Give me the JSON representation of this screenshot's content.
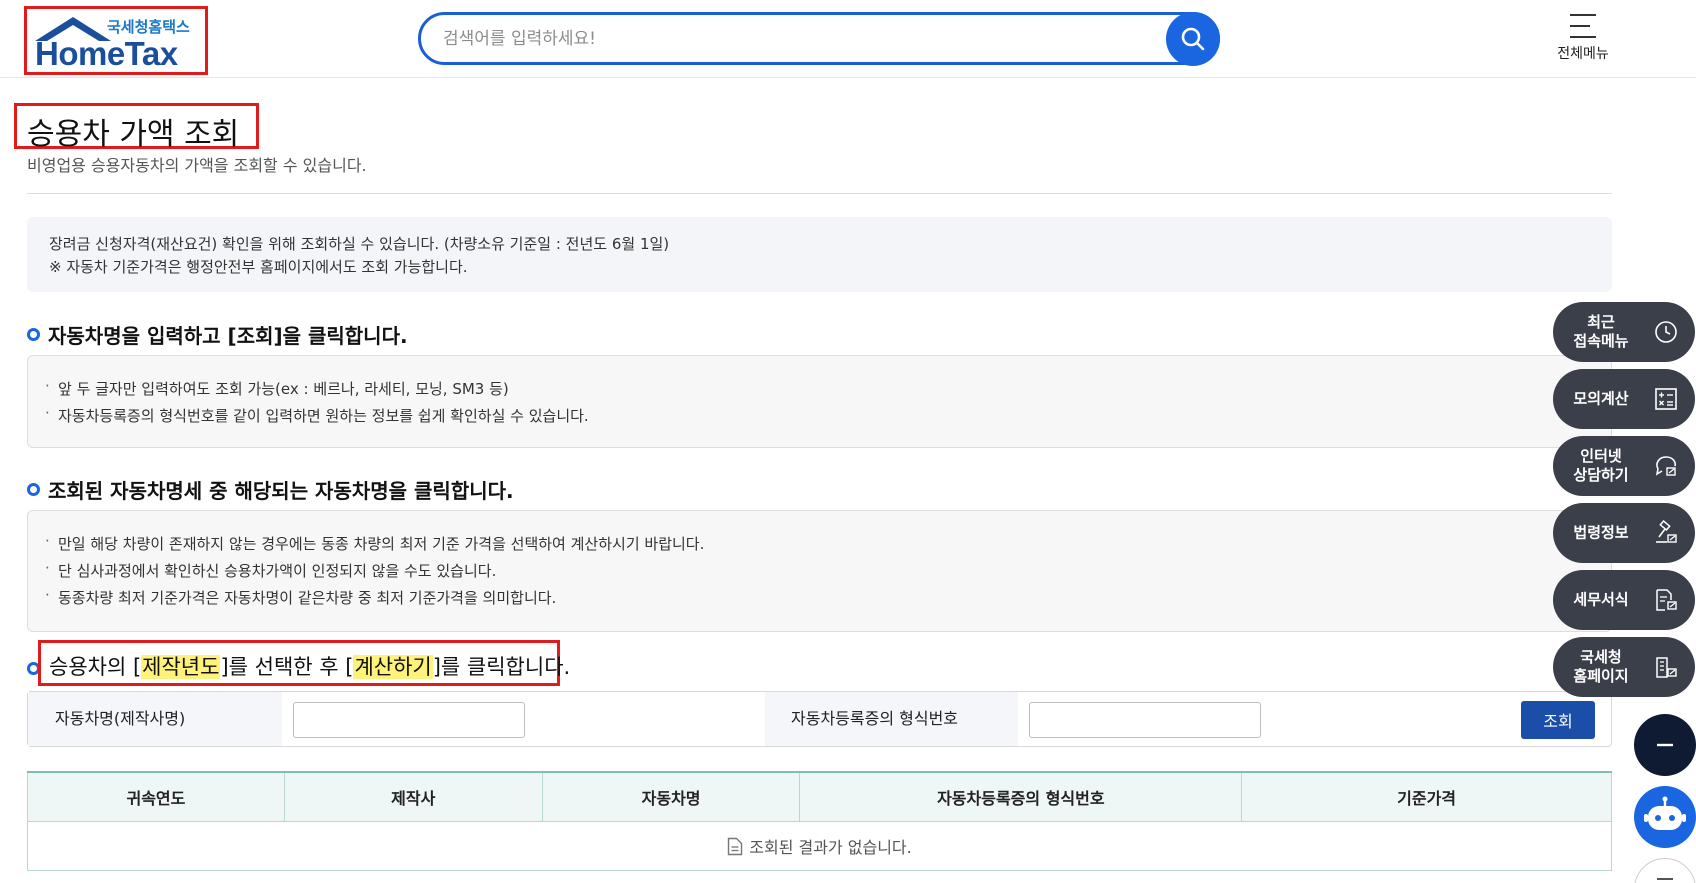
{
  "header": {
    "logo_sub": "국세청홈택스",
    "logo_main": "HomeTax",
    "search_placeholder": "검색어를 입력하세요!",
    "menu_label": "전체메뉴"
  },
  "page": {
    "title": "승용차 가액 조회",
    "description": "비영업용 승용자동차의 가액을 조회할 수 있습니다."
  },
  "info": {
    "line1": "장려금 신청자격(재산요건) 확인을 위해 조회하실 수 있습니다. (차량소유 기준일 : 전년도 6월 1일)",
    "line2": "※ 자동차 기준가격은 행정안전부 홈페이지에서도 조회 가능합니다."
  },
  "step1": {
    "heading": "자동차명을 입력하고 [조회]을 클릭합니다.",
    "items": [
      "앞 두 글자만 입력하여도 조회 가능(ex : 베르나, 라세티, 모닝, SM3 등)",
      "자동차등록증의 형식번호를 같이 입력하면 원하는 정보를 쉽게 확인하실 수 있습니다."
    ]
  },
  "step2": {
    "heading": "조회된 자동차명세 중 해당되는 자동차명을 클릭합니다.",
    "items": [
      "만일 해당 차량이 존재하지 않는 경우에는 동종 차량의 최저 기준 가격을 선택하여 계산하시기 바랍니다.",
      "단 심사과정에서 확인하신 승용차가액이 인정되지 않을 수도 있습니다.",
      "동종차량 최저 기준가격은 자동차명이 같은차량 중  최저 기준가격을 의미합니다."
    ]
  },
  "step3": {
    "prefix": "승용차의 [",
    "highlight1": "제작년도",
    "middle": "]를 선택한 후 [",
    "highlight2": "계산하기",
    "suffix": "]를 클릭합니다."
  },
  "form": {
    "car_name_label": "자동차명(제작사명)",
    "car_name_value": "",
    "type_number_label": "자동차등록증의 형식번호",
    "type_number_value": "",
    "search_button": "조회"
  },
  "table": {
    "columns": [
      "귀속연도",
      "제작사",
      "자동차명",
      "자동차등록증의 형식번호",
      "기준가격"
    ],
    "empty_message": "조회된 결과가 없습니다."
  },
  "quick_menu": [
    {
      "label_line1": "최근",
      "label_line2": "접속메뉴",
      "icon": "clock-icon"
    },
    {
      "label_line1": "모의계산",
      "label_line2": "",
      "icon": "calculator-icon"
    },
    {
      "label_line1": "인터넷",
      "label_line2": "상담하기",
      "icon": "chat-icon"
    },
    {
      "label_line1": "법령정보",
      "label_line2": "",
      "icon": "gavel-icon"
    },
    {
      "label_line1": "세무서식",
      "label_line2": "",
      "icon": "document-icon"
    },
    {
      "label_line1": "국세청",
      "label_line2": "홈페이지",
      "icon": "building-icon"
    }
  ],
  "colors": {
    "brand_blue": "#1a66e0",
    "highlight_red": "#e01b1b",
    "quick_menu_bg": "#3a3f4a",
    "primary_button": "#1a4ea8"
  }
}
